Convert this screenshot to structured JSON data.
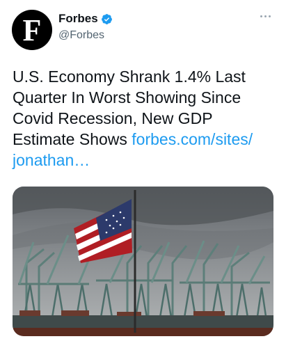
{
  "account": {
    "avatar_letter": "F",
    "display_name": "Forbes",
    "handle": "@Forbes",
    "verified": true
  },
  "tweet": {
    "text": "U.S. Economy Shrank 1.4% Last Quarter In Worst Showing Since Covid Recession, New GDP Estimate Shows ",
    "link_text": "forbes.com/sites/​jonathan…"
  },
  "media": {
    "icon": "flag-over-port-cranes-photo"
  },
  "colors": {
    "link": "#1d9bf0",
    "verified": "#1d9bf0",
    "text": "#0f1419",
    "secondary": "#536471"
  }
}
